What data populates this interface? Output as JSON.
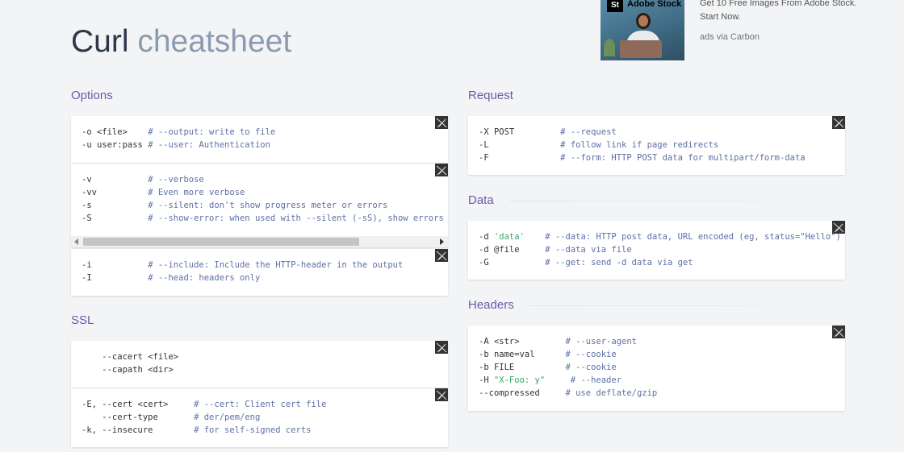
{
  "header": {
    "title_main": "Curl",
    "title_sub": "cheatsheet"
  },
  "ad": {
    "image_brand": "Adobe Stock",
    "image_logo": "St",
    "text": "Get 10 Free Images From Adobe Stock. Start Now.",
    "via": "ads via Carbon"
  },
  "sections": {
    "options": "Options",
    "ssl": "SSL",
    "request": "Request",
    "data": "Data",
    "headers": "Headers"
  },
  "options": {
    "block1": [
      {
        "flag": "-o ",
        "arg": "<file>",
        "pad": "    ",
        "comment": "# --output: write to file"
      },
      {
        "flag": "-u user:pass",
        "arg": "",
        "pad": " ",
        "comment": "# --user: Authentication"
      }
    ],
    "block2": [
      {
        "flag": "-v",
        "pad": "           ",
        "comment": "# --verbose"
      },
      {
        "flag": "-vv",
        "pad": "          ",
        "comment": "# Even more verbose"
      },
      {
        "flag": "-s",
        "pad": "           ",
        "comment": "# --silent: don't show progress meter or errors"
      },
      {
        "flag": "-S",
        "pad": "           ",
        "comment": "# --show-error: when used with --silent (-sS), show errors but no progress meter"
      }
    ],
    "block3": [
      {
        "flag": "-i",
        "pad": "           ",
        "comment": "# --include: Include the HTTP-header in the output"
      },
      {
        "flag": "-I",
        "pad": "           ",
        "comment": "# --head: headers only"
      }
    ]
  },
  "ssl": {
    "block1": [
      {
        "flag": "    --cacert ",
        "arg": "<file>"
      },
      {
        "flag": "    --capath ",
        "arg": "<dir>"
      }
    ],
    "block2": [
      {
        "flag": "-E, --cert ",
        "arg": "<cert>",
        "pad": "     ",
        "comment": "# --cert: Client cert file"
      },
      {
        "flag": "    --cert-type",
        "arg": "",
        "pad": "       ",
        "comment": "# der/pem/eng"
      },
      {
        "flag": "-k, --insecure",
        "arg": "",
        "pad": "        ",
        "comment": "# for self-signed certs"
      }
    ]
  },
  "request": [
    {
      "flag": "-X POST",
      "pad": "         ",
      "comment": "# --request"
    },
    {
      "flag": "-L",
      "pad": "              ",
      "comment": "# follow link if page redirects"
    },
    {
      "flag": "-F",
      "pad": "              ",
      "comment": "# --form: HTTP POST data for multipart/form-data"
    }
  ],
  "data": [
    {
      "flag": "-d ",
      "str": "'data'",
      "pad": "    ",
      "comment": "# --data: HTTP post data, URL encoded (eg, status=\"Hello\")"
    },
    {
      "flag": "-d @file",
      "str": "",
      "pad": "     ",
      "comment": "# --data via file"
    },
    {
      "flag": "-G",
      "str": "",
      "pad": "           ",
      "comment": "# --get: send -d data via get"
    }
  ],
  "headers": [
    {
      "flag": "-A ",
      "arg": "<str>",
      "str": "",
      "pad": "         ",
      "comment": "# --user-agent"
    },
    {
      "flag": "-b name=val",
      "arg": "",
      "str": "",
      "pad": "      ",
      "comment": "# --cookie"
    },
    {
      "flag": "-b FILE",
      "arg": "",
      "str": "",
      "pad": "          ",
      "comment": "# --cookie"
    },
    {
      "flag": "-H ",
      "arg": "",
      "str": "\"X-Foo: y\"",
      "pad": "     ",
      "comment": "# --header"
    },
    {
      "flag": "--compressed",
      "arg": "",
      "str": "",
      "pad": "     ",
      "comment": "# use deflate/gzip"
    }
  ],
  "icons": {
    "block_marker": "expand-icon"
  },
  "colors": {
    "accent": "#6b5aa6",
    "comment": "#5e6fa5",
    "string": "#3aa46d"
  }
}
